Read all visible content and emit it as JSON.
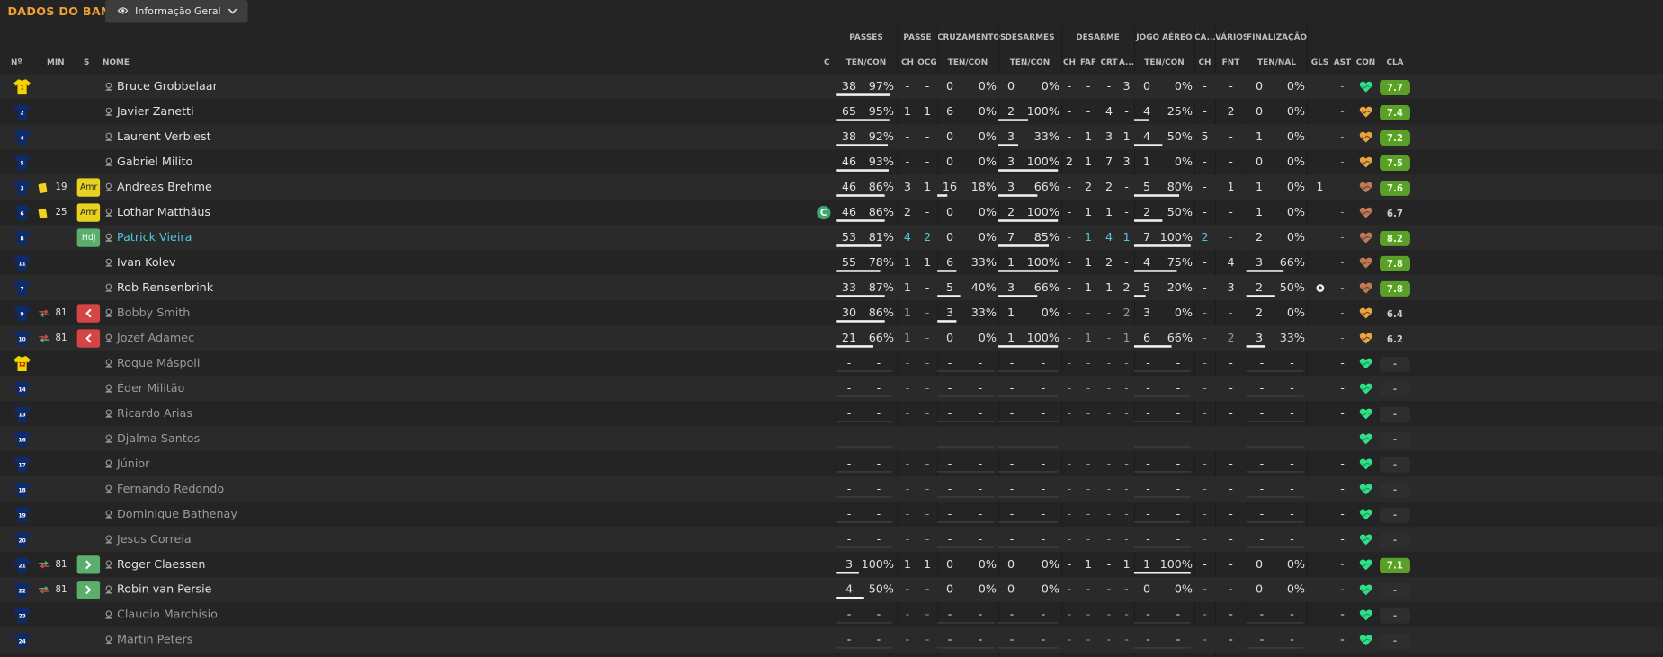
{
  "title": "DADOS DO BANGU",
  "view_selector": {
    "label": "Informação Geral",
    "icon": "eye-icon"
  },
  "header_groups": {
    "passes": "PASSES",
    "passe": "PASSE",
    "cruzamentos": "CRUZAMENTOS",
    "desarmes": "DESARMES",
    "desarme": "DESARME",
    "jogo_aereo": "JOGO AÉREO",
    "ca": "CA...",
    "varios": "VÁRIOS",
    "finalizacao": "FINALIZAÇÃO"
  },
  "columns": {
    "num": "Nº",
    "min": "MIN",
    "s": "S",
    "nome": "NOME",
    "c": "C",
    "passes": "TEN/CON",
    "passe_ch": "CH",
    "passe_ocg": "OCG",
    "cruz": "TEN/CON",
    "des": "TEN/CON",
    "dsr_ch": "CH",
    "dsr_faf": "FAF",
    "dsr_crt": "CRT",
    "dsr_a": "A...",
    "aereo": "TEN/CON",
    "ca_ch": "CH",
    "fnt": "FNT",
    "fin": "TEN/NAL",
    "gls": "GLS",
    "ast": "AST",
    "con": "CON",
    "cla": "CLA"
  },
  "colors": {
    "accent": "#f0a030",
    "rating_good": "#5aa028",
    "highlight": "#4dc8e0",
    "card_yellow": "#f2d11a",
    "sub_out": "#d64545",
    "sub_in": "#5cae6c"
  },
  "players": [
    {
      "num": "1",
      "gk": true,
      "min": "",
      "card": false,
      "badge": "",
      "name": "Bruce Grobbelaar",
      "style": "normal",
      "cap": false,
      "p": [
        "38",
        "97%"
      ],
      "pch": "-",
      "pocg": "-",
      "cr": [
        "0",
        "0%"
      ],
      "de": [
        "0",
        "0%"
      ],
      "dch": "-",
      "faf": "-",
      "crt": "-",
      "a": "3",
      "ae": [
        "0",
        "0%"
      ],
      "cach": "-",
      "fnt": "-",
      "fi": [
        "0",
        "0%"
      ],
      "gls": "",
      "gls_icon": false,
      "ast": "-",
      "con": "green",
      "cla": "7.7",
      "cla_style": "g",
      "pbar": 0.96,
      "crbar": 0,
      "debar": 0,
      "aebar": 0,
      "fibar": 0
    },
    {
      "num": "2",
      "gk": false,
      "min": "",
      "card": false,
      "badge": "",
      "name": "Javier Zanetti",
      "style": "normal",
      "cap": false,
      "p": [
        "65",
        "95%"
      ],
      "pch": "1",
      "pocg": "1",
      "cr": [
        "6",
        "0%"
      ],
      "de": [
        "2",
        "100%"
      ],
      "dch": "-",
      "faf": "-",
      "crt": "4",
      "a": "-",
      "ae": [
        "4",
        "25%"
      ],
      "cach": "-",
      "fnt": "2",
      "fi": [
        "0",
        "0%"
      ],
      "gls": "",
      "gls_icon": false,
      "ast": "-",
      "con": "orange",
      "cla": "7.4",
      "cla_style": "g",
      "pbar": 0.95,
      "crbar": 0,
      "debar": 0.5,
      "aebar": 0.25,
      "fibar": 0
    },
    {
      "num": "4",
      "gk": false,
      "min": "",
      "card": false,
      "badge": "",
      "name": "Laurent Verbiest",
      "style": "normal",
      "cap": false,
      "p": [
        "38",
        "92%"
      ],
      "pch": "-",
      "pocg": "-",
      "cr": [
        "0",
        "0%"
      ],
      "de": [
        "3",
        "33%"
      ],
      "dch": "-",
      "faf": "1",
      "crt": "3",
      "a": "1",
      "ae": [
        "4",
        "50%"
      ],
      "cach": "5",
      "fnt": "-",
      "fi": [
        "1",
        "0%"
      ],
      "gls": "",
      "gls_icon": false,
      "ast": "-",
      "con": "orange",
      "cla": "7.2",
      "cla_style": "g",
      "pbar": 0.92,
      "crbar": 0,
      "debar": 0.33,
      "aebar": 0.5,
      "fibar": 0
    },
    {
      "num": "5",
      "gk": false,
      "min": "",
      "card": false,
      "badge": "",
      "name": "Gabriel Milito",
      "style": "normal",
      "cap": false,
      "p": [
        "46",
        "93%"
      ],
      "pch": "-",
      "pocg": "-",
      "cr": [
        "0",
        "0%"
      ],
      "de": [
        "3",
        "100%"
      ],
      "dch": "2",
      "faf": "1",
      "crt": "7",
      "a": "3",
      "ae": [
        "1",
        "0%"
      ],
      "cach": "-",
      "fnt": "-",
      "fi": [
        "0",
        "0%"
      ],
      "gls": "",
      "gls_icon": false,
      "ast": "-",
      "con": "orange",
      "cla": "7.5",
      "cla_style": "g",
      "pbar": 0.93,
      "crbar": 0,
      "debar": 1,
      "aebar": 0,
      "fibar": 0
    },
    {
      "num": "3",
      "gk": false,
      "min": "19",
      "card": true,
      "badge": "Amr",
      "name": "Andreas Brehme",
      "style": "normal",
      "cap": false,
      "p": [
        "46",
        "86%"
      ],
      "pch": "3",
      "pocg": "1",
      "cr": [
        "16",
        "18%"
      ],
      "de": [
        "3",
        "66%"
      ],
      "dch": "-",
      "faf": "2",
      "crt": "2",
      "a": "-",
      "ae": [
        "5",
        "80%"
      ],
      "cach": "-",
      "fnt": "1",
      "fi": [
        "1",
        "0%"
      ],
      "gls": "1",
      "gls_icon": false,
      "ast": "",
      "con": "brown",
      "cla": "7.6",
      "cla_style": "g",
      "pbar": 0.86,
      "crbar": 0.18,
      "debar": 0.66,
      "aebar": 0.8,
      "fibar": 0
    },
    {
      "num": "6",
      "gk": false,
      "min": "25",
      "card": true,
      "badge": "Amr",
      "name": "Lothar Matthäus",
      "style": "normal",
      "cap": true,
      "p": [
        "46",
        "86%"
      ],
      "pch": "2",
      "pocg": "-",
      "cr": [
        "0",
        "0%"
      ],
      "de": [
        "2",
        "100%"
      ],
      "dch": "-",
      "faf": "1",
      "crt": "1",
      "a": "-",
      "ae": [
        "2",
        "50%"
      ],
      "cach": "-",
      "fnt": "-",
      "fi": [
        "1",
        "0%"
      ],
      "gls": "",
      "gls_icon": false,
      "ast": "-",
      "con": "brown",
      "cla": "6.7",
      "cla_style": "n",
      "pbar": 0.86,
      "crbar": 0,
      "debar": 1,
      "aebar": 0.5,
      "fibar": 0
    },
    {
      "num": "8",
      "gk": false,
      "min": "",
      "card": false,
      "badge": "HdJ",
      "name": "Patrick Vieira",
      "style": "hl",
      "cap": false,
      "p": [
        "53",
        "81%"
      ],
      "pch": "4",
      "pocg": "2",
      "cr": [
        "0",
        "0%"
      ],
      "de": [
        "7",
        "85%"
      ],
      "dch": "-",
      "faf": "1",
      "crt": "4",
      "a": "1",
      "ae": [
        "7",
        "100%"
      ],
      "cach": "2",
      "fnt": "-",
      "fi": [
        "2",
        "0%"
      ],
      "gls": "",
      "gls_icon": false,
      "ast": "-",
      "con": "brown",
      "cla": "8.2",
      "cla_style": "g",
      "pbar": 0.81,
      "crbar": 0,
      "debar": 0.85,
      "aebar": 1,
      "fibar": 0
    },
    {
      "num": "11",
      "gk": false,
      "min": "",
      "card": false,
      "badge": "",
      "name": "Ivan Kolev",
      "style": "normal",
      "cap": false,
      "p": [
        "55",
        "78%"
      ],
      "pch": "1",
      "pocg": "1",
      "cr": [
        "6",
        "33%"
      ],
      "de": [
        "1",
        "100%"
      ],
      "dch": "-",
      "faf": "1",
      "crt": "2",
      "a": "-",
      "ae": [
        "4",
        "75%"
      ],
      "cach": "-",
      "fnt": "4",
      "fi": [
        "3",
        "66%"
      ],
      "gls": "",
      "gls_icon": false,
      "ast": "-",
      "con": "brown",
      "cla": "7.8",
      "cla_style": "g",
      "pbar": 0.78,
      "crbar": 0.33,
      "debar": 1,
      "aebar": 0.75,
      "fibar": 0.66
    },
    {
      "num": "7",
      "gk": false,
      "min": "",
      "card": false,
      "badge": "",
      "name": "Rob Rensenbrink",
      "style": "normal",
      "cap": false,
      "p": [
        "33",
        "87%"
      ],
      "pch": "1",
      "pocg": "-",
      "cr": [
        "5",
        "40%"
      ],
      "de": [
        "3",
        "66%"
      ],
      "dch": "-",
      "faf": "1",
      "crt": "1",
      "a": "2",
      "ae": [
        "5",
        "20%"
      ],
      "cach": "-",
      "fnt": "3",
      "fi": [
        "2",
        "50%"
      ],
      "gls": "",
      "gls_icon": true,
      "ast": "-",
      "con": "brown",
      "cla": "7.8",
      "cla_style": "g",
      "pbar": 0.87,
      "crbar": 0.4,
      "debar": 0.66,
      "aebar": 0.2,
      "fibar": 0.5
    },
    {
      "num": "9",
      "gk": false,
      "min": "81",
      "sub": "out",
      "card": false,
      "badge": "out",
      "name": "Bobby Smith",
      "style": "dim",
      "cap": false,
      "p": [
        "30",
        "86%"
      ],
      "pch": "1",
      "pocg": "-",
      "cr": [
        "3",
        "33%"
      ],
      "de": [
        "1",
        "0%"
      ],
      "dch": "-",
      "faf": "-",
      "crt": "-",
      "a": "2",
      "ae": [
        "3",
        "0%"
      ],
      "cach": "-",
      "fnt": "-",
      "fi": [
        "2",
        "0%"
      ],
      "gls": "",
      "gls_icon": false,
      "ast": "-",
      "con": "orange",
      "cla": "6.4",
      "cla_style": "n",
      "pbar": 0.86,
      "crbar": 0.33,
      "debar": 0,
      "aebar": 0,
      "fibar": 0
    },
    {
      "num": "10",
      "gk": false,
      "min": "81",
      "sub": "out",
      "card": false,
      "badge": "out",
      "name": "Jozef Adamec",
      "style": "dim",
      "cap": false,
      "p": [
        "21",
        "66%"
      ],
      "pch": "1",
      "pocg": "-",
      "cr": [
        "0",
        "0%"
      ],
      "de": [
        "1",
        "100%"
      ],
      "dch": "-",
      "faf": "1",
      "crt": "-",
      "a": "1",
      "ae": [
        "6",
        "66%"
      ],
      "cach": "-",
      "fnt": "2",
      "fi": [
        "3",
        "33%"
      ],
      "gls": "",
      "gls_icon": false,
      "ast": "-",
      "con": "orange",
      "cla": "6.2",
      "cla_style": "n",
      "pbar": 0.66,
      "crbar": 0,
      "debar": 1,
      "aebar": 0.66,
      "fibar": 0.33
    },
    {
      "num": "12",
      "gk": true,
      "min": "",
      "card": false,
      "badge": "",
      "name": "Roque Máspoli",
      "style": "dim",
      "empty": true
    },
    {
      "num": "14",
      "gk": false,
      "min": "",
      "card": false,
      "badge": "",
      "name": "Éder Militão",
      "style": "dim",
      "empty": true
    },
    {
      "num": "13",
      "gk": false,
      "min": "",
      "card": false,
      "badge": "",
      "name": "Ricardo Arias",
      "style": "dim",
      "empty": true
    },
    {
      "num": "16",
      "gk": false,
      "min": "",
      "card": false,
      "badge": "",
      "name": "Djalma Santos",
      "style": "dim",
      "empty": true
    },
    {
      "num": "17",
      "gk": false,
      "min": "",
      "card": false,
      "badge": "",
      "name": "Júnior",
      "style": "dim",
      "empty": true
    },
    {
      "num": "18",
      "gk": false,
      "min": "",
      "card": false,
      "badge": "",
      "name": "Fernando Redondo",
      "style": "dim",
      "empty": true
    },
    {
      "num": "19",
      "gk": false,
      "min": "",
      "card": false,
      "badge": "",
      "name": "Dominique Bathenay",
      "style": "dim",
      "empty": true
    },
    {
      "num": "20",
      "gk": false,
      "min": "",
      "card": false,
      "badge": "",
      "name": "Jesus Correia",
      "style": "dim",
      "empty": true
    },
    {
      "num": "21",
      "gk": false,
      "min": "81",
      "sub": "in",
      "card": false,
      "badge": "in",
      "name": "Roger Claessen",
      "style": "normal",
      "cap": false,
      "p": [
        "3",
        "100%"
      ],
      "pch": "1",
      "pocg": "1",
      "cr": [
        "0",
        "0%"
      ],
      "de": [
        "0",
        "0%"
      ],
      "dch": "-",
      "faf": "1",
      "crt": "-",
      "a": "1",
      "ae": [
        "1",
        "100%"
      ],
      "cach": "-",
      "fnt": "-",
      "fi": [
        "0",
        "0%"
      ],
      "gls": "",
      "gls_icon": false,
      "ast": "-",
      "con": "green",
      "cla": "7.1",
      "cla_style": "g",
      "pbar": 0.4,
      "crbar": 0,
      "debar": 0,
      "aebar": 1,
      "fibar": 0
    },
    {
      "num": "22",
      "gk": false,
      "min": "81",
      "sub": "in",
      "card": false,
      "badge": "in",
      "name": "Robin van Persie",
      "style": "normal",
      "cap": false,
      "p": [
        "4",
        "50%"
      ],
      "pch": "-",
      "pocg": "-",
      "cr": [
        "0",
        "0%"
      ],
      "de": [
        "0",
        "0%"
      ],
      "dch": "-",
      "faf": "-",
      "crt": "-",
      "a": "-",
      "ae": [
        "0",
        "0%"
      ],
      "cach": "-",
      "fnt": "-",
      "fi": [
        "0",
        "0%"
      ],
      "gls": "",
      "gls_icon": false,
      "ast": "-",
      "con": "green",
      "cla": "-",
      "cla_style": "d",
      "pbar": 0.5,
      "crbar": 0,
      "debar": 0,
      "aebar": 0,
      "fibar": 0
    },
    {
      "num": "23",
      "gk": false,
      "min": "",
      "card": false,
      "badge": "",
      "name": "Claudio Marchisio",
      "style": "dim",
      "empty": true
    },
    {
      "num": "24",
      "gk": false,
      "min": "",
      "card": false,
      "badge": "",
      "name": "Martin Peters",
      "style": "dim",
      "empty": true
    }
  ]
}
